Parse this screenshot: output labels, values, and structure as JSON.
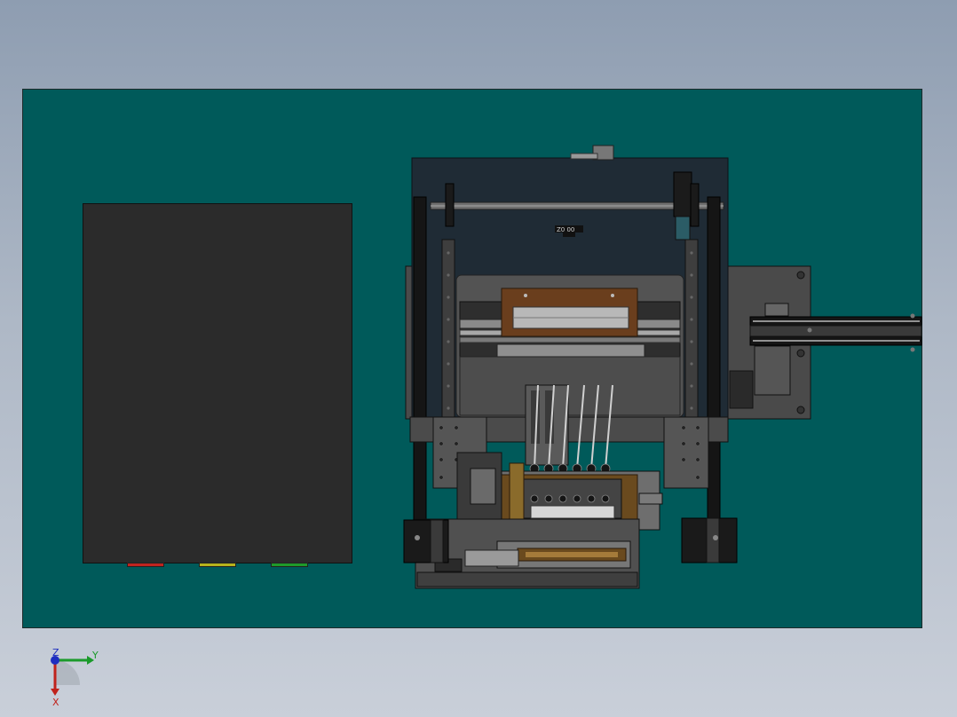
{
  "machine": {
    "plate_label": "Z0   00"
  },
  "axis_triad": {
    "z_label": "Z",
    "y_label": "Y",
    "x_label": "X"
  },
  "colors": {
    "background_top": "#8e9db1",
    "background_bottom": "#c9cfd9",
    "base_plate": "#005a5a",
    "cabinet": "#2b2b2b",
    "frame": "#1f2b35",
    "lamp_red": "#c0241f",
    "lamp_yellow": "#b7b21c",
    "lamp_green": "#1f9a2a",
    "axis_x": "#c0221c",
    "axis_y": "#1a9a2a",
    "axis_z": "#1d2ec0"
  },
  "icons": {
    "triad": "coordinate-axis-triad-icon"
  }
}
